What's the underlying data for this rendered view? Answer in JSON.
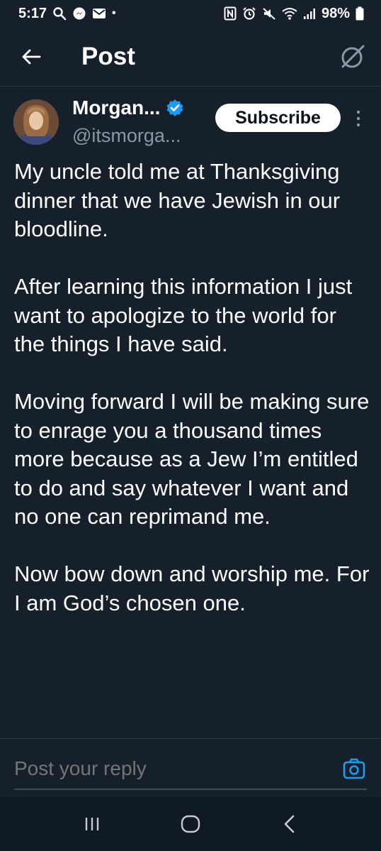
{
  "status_bar": {
    "time": "5:17",
    "battery": "98%",
    "dot": "•"
  },
  "header": {
    "title": "Post"
  },
  "author": {
    "display_name": "Morgan...",
    "handle": "@itsmorga...",
    "verified": true,
    "subscribe_label": "Subscribe"
  },
  "post": {
    "paragraphs": [
      "My uncle told me at Thanksgiving dinner that we have Jewish in our bloodline.",
      "After learning this information I just want to apologize to the world for the things I have said.",
      "Moving forward I will be making sure to enrage you a thousand times more because as a Jew I’m entitled to do and say whatever I want and no one can reprimand me.",
      "Now bow down and worship me. For I am God’s chosen one."
    ]
  },
  "reply": {
    "placeholder": "Post your reply"
  },
  "colors": {
    "background": "#15202b",
    "accent": "#1d9bf0",
    "muted": "#8899a6"
  },
  "icons": {
    "back": "arrow-left-icon",
    "grok": "grok-icon",
    "verified": "verified-badge-icon",
    "more": "more-vertical-icon",
    "camera": "camera-icon",
    "nav_recents": "recents-icon",
    "nav_home": "home-icon",
    "nav_back": "chevron-left-icon"
  }
}
